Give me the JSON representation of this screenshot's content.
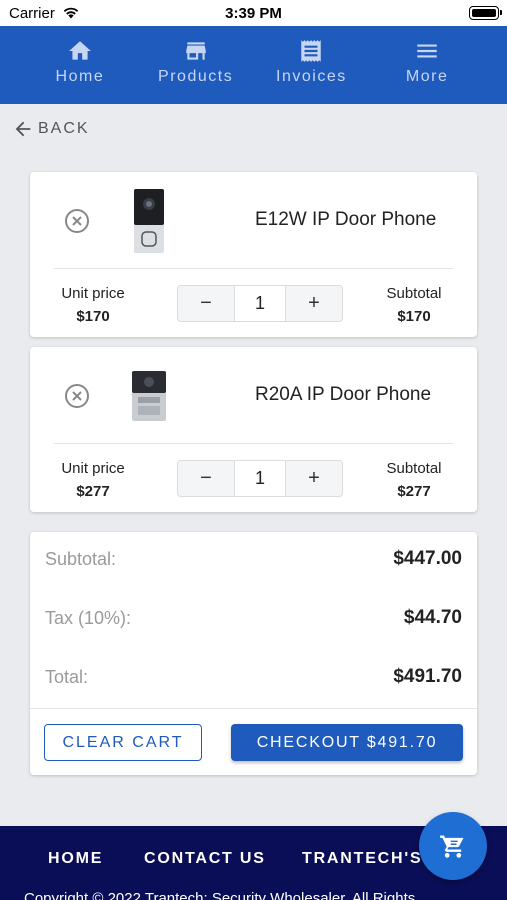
{
  "status_bar": {
    "carrier": "Carrier",
    "time": "3:39 PM"
  },
  "nav": {
    "items": [
      {
        "label": "Home",
        "icon": "home-icon"
      },
      {
        "label": "Products",
        "icon": "store-icon"
      },
      {
        "label": "Invoices",
        "icon": "receipt-icon"
      },
      {
        "label": "More",
        "icon": "menu-icon"
      }
    ]
  },
  "back_label": "BACK",
  "cart": {
    "items": [
      {
        "name": "E12W IP Door Phone",
        "unit_price_label": "Unit price",
        "unit_price": "$170",
        "quantity": "1",
        "subtotal_label": "Subtotal",
        "subtotal": "$170"
      },
      {
        "name": "R20A IP Door Phone",
        "unit_price_label": "Unit price",
        "unit_price": "$277",
        "quantity": "1",
        "subtotal_label": "Subtotal",
        "subtotal": "$277"
      }
    ],
    "stepper": {
      "minus": "−",
      "plus": "+"
    }
  },
  "summary": {
    "subtotal_label": "Subtotal:",
    "subtotal": "$447.00",
    "tax_label": "Tax (10%):",
    "tax": "$44.70",
    "total_label": "Total:",
    "total": "$491.70"
  },
  "actions": {
    "clear": "CLEAR CART",
    "checkout": "CHECKOUT $491.70"
  },
  "footer": {
    "links": [
      "HOME",
      "CONTACT US",
      "TRANTECH'S"
    ],
    "copyright": "Copyright © 2022 Trantech: Security Wholesaler. All Rights"
  },
  "colors": {
    "primary": "#1f5bbd",
    "footer_bg": "#0a0e57",
    "fab": "#1f6ed4"
  }
}
